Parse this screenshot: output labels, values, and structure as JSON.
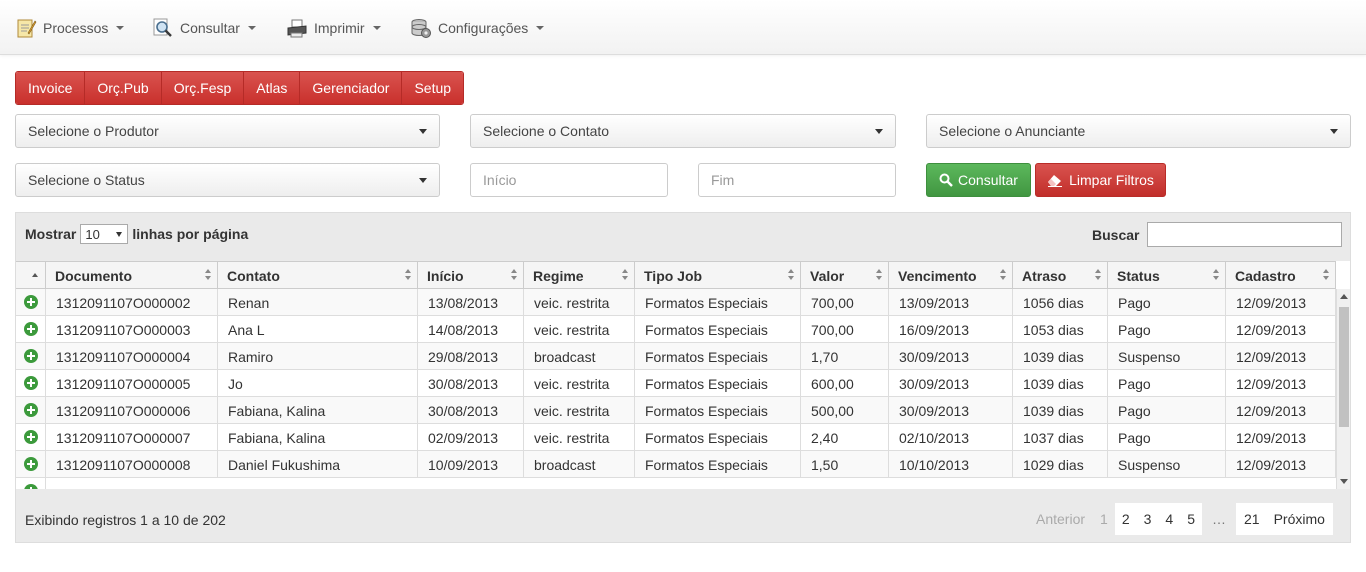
{
  "nav": {
    "items": [
      {
        "label": "Processos",
        "icon": "notepad-icon"
      },
      {
        "label": "Consultar",
        "icon": "magnifier-icon"
      },
      {
        "label": "Imprimir",
        "icon": "printer-icon"
      },
      {
        "label": "Configurações",
        "icon": "database-icon"
      }
    ]
  },
  "modules": [
    "Invoice",
    "Orç.Pub",
    "Orç.Fesp",
    "Atlas",
    "Gerenciador",
    "Setup"
  ],
  "filters": {
    "produtor": "Selecione o Produtor",
    "contato": "Selecione o Contato",
    "anunciante": "Selecione o Anunciante",
    "status": "Selecione o Status",
    "inicio_placeholder": "Início",
    "fim_placeholder": "Fim",
    "consultar_label": "Consultar",
    "limpar_label": "Limpar Filtros"
  },
  "table": {
    "show_prefix": "Mostrar",
    "page_length": "10",
    "show_suffix": "linhas por página",
    "search_label": "Buscar",
    "columns": [
      "Documento",
      "Contato",
      "Início",
      "Regime",
      "Tipo Job",
      "Valor",
      "Vencimento",
      "Atraso",
      "Status",
      "Cadastro"
    ],
    "rows": [
      [
        "1312091107O000002",
        "Renan",
        "13/08/2013",
        "veic. restrita",
        "Formatos Especiais",
        "700,00",
        "13/09/2013",
        "1056 dias",
        "Pago",
        "12/09/2013"
      ],
      [
        "1312091107O000003",
        "Ana L",
        "14/08/2013",
        "veic. restrita",
        "Formatos Especiais",
        "700,00",
        "16/09/2013",
        "1053 dias",
        "Pago",
        "12/09/2013"
      ],
      [
        "1312091107O000004",
        "Ramiro",
        "29/08/2013",
        "broadcast",
        "Formatos Especiais",
        "1,70",
        "30/09/2013",
        "1039 dias",
        "Suspenso",
        "12/09/2013"
      ],
      [
        "1312091107O000005",
        "Jo",
        "30/08/2013",
        "veic. restrita",
        "Formatos Especiais",
        "600,00",
        "30/09/2013",
        "1039 dias",
        "Pago",
        "12/09/2013"
      ],
      [
        "1312091107O000006",
        "Fabiana, Kalina",
        "30/08/2013",
        "veic. restrita",
        "Formatos Especiais",
        "500,00",
        "30/09/2013",
        "1039 dias",
        "Pago",
        "12/09/2013"
      ],
      [
        "1312091107O000007",
        "Fabiana, Kalina",
        "02/09/2013",
        "veic. restrita",
        "Formatos Especiais",
        "2,40",
        "02/10/2013",
        "1037 dias",
        "Pago",
        "12/09/2013"
      ],
      [
        "1312091107O000008",
        "Daniel Fukushima",
        "10/09/2013",
        "broadcast",
        "Formatos Especiais",
        "1,50",
        "10/10/2013",
        "1029 dias",
        "Suspenso",
        "12/09/2013"
      ]
    ],
    "info": "Exibindo registros 1 a 10 de 202",
    "pagination": [
      "Anterior",
      "1",
      "2",
      "3",
      "4",
      "5",
      "…",
      "21",
      "Próximo"
    ]
  }
}
